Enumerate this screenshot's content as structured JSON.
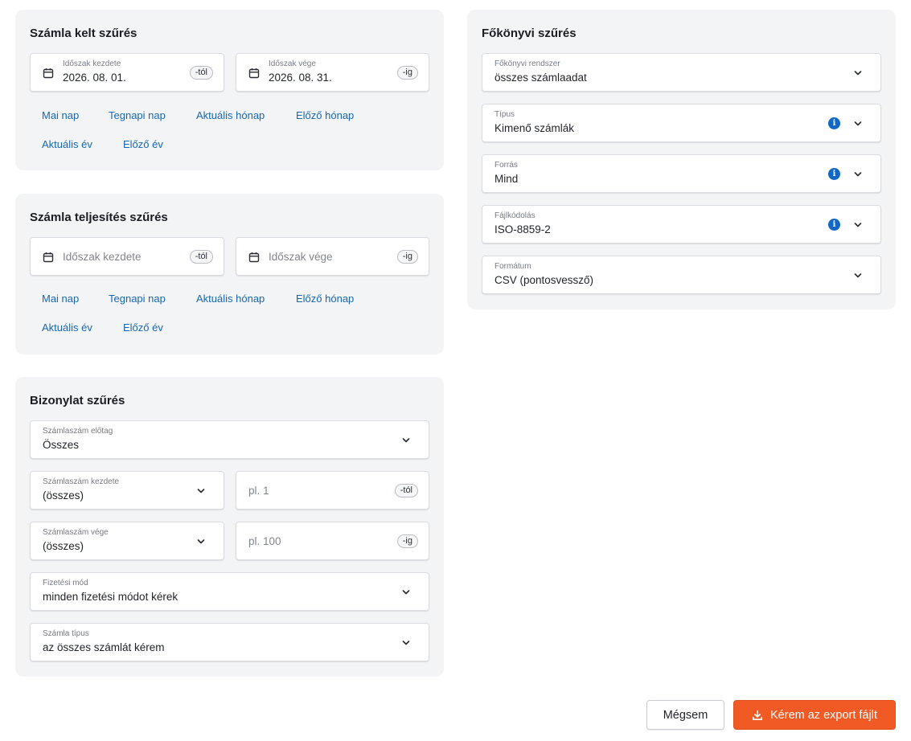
{
  "invoice_date_filter": {
    "title": "Számla kelt szűrés",
    "start": {
      "label": "Időszak kezdete",
      "value": "2026. 08. 01.",
      "suffix": "-tól"
    },
    "end": {
      "label": "Időszak vége",
      "value": "2026. 08. 31.",
      "suffix": "-ig"
    },
    "quick_links": [
      "Mai nap",
      "Tegnapi nap",
      "Aktuális hónap",
      "Előző hónap",
      "Aktuális év",
      "Előző év"
    ]
  },
  "fulfillment_filter": {
    "title": "Számla teljesítés szűrés",
    "start": {
      "placeholder": "Időszak kezdete",
      "suffix": "-tól"
    },
    "end": {
      "placeholder": "Időszak vége",
      "suffix": "-ig"
    },
    "quick_links": [
      "Mai nap",
      "Tegnapi nap",
      "Aktuális hónap",
      "Előző hónap",
      "Aktuális év",
      "Előző év"
    ]
  },
  "document_filter": {
    "title": "Bizonylat szűrés",
    "prefix": {
      "label": "Számlaszám előtag",
      "value": "Összes"
    },
    "number_start": {
      "label": "Számlaszám kezdete",
      "value": "(összes)",
      "placeholder": "pl. 1",
      "suffix": "-tól"
    },
    "number_end": {
      "label": "Számlaszám vége",
      "value": "(összes)",
      "placeholder": "pl. 100",
      "suffix": "-ig"
    },
    "payment_method": {
      "label": "Fizetési mód",
      "value": "minden fizetési módot kérek"
    },
    "invoice_type": {
      "label": "Számla típus",
      "value": "az összes számlát kérem"
    }
  },
  "ledger_filter": {
    "title": "Főkönyvi szűrés",
    "system": {
      "label": "Főkönyvi rendszer",
      "value": "összes számlaadat"
    },
    "type": {
      "label": "Típus",
      "value": "Kimenő számlák",
      "info": "i"
    },
    "source": {
      "label": "Forrás",
      "value": "Mind",
      "info": "i"
    },
    "encoding": {
      "label": "Fájlkódolás",
      "value": "ISO-8859-2",
      "info": "i"
    },
    "format": {
      "label": "Formátum",
      "value": "CSV (pontosvessző)"
    }
  },
  "actions": {
    "cancel_label": "Mégsem",
    "export_label": "Kérem az export fájlt"
  },
  "colors": {
    "link": "#1a66b0",
    "info": "#1268c6",
    "primary": "#f15a24",
    "card_bg": "#f3f4f6"
  },
  "icons": [
    "calendar-icon",
    "chevron-down-icon",
    "info-icon",
    "download-icon"
  ]
}
